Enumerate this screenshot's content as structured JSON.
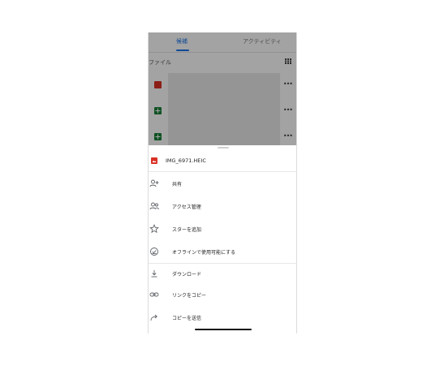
{
  "background_app": {
    "tabs": [
      {
        "label": "候補",
        "active": true
      },
      {
        "label": "アクティビティ",
        "active": false
      }
    ],
    "section_label": "ファイル",
    "files": [
      {
        "icon": "image-file-icon",
        "color": "#d93025"
      },
      {
        "icon": "sheets-file-icon",
        "color": "#188038"
      },
      {
        "icon": "sheets-file-icon",
        "color": "#188038"
      }
    ],
    "more_label": "•••"
  },
  "sheet": {
    "file_name": "IMG_6971.HEIC",
    "file_icon": "image-file-icon",
    "menu_groups": [
      [
        {
          "label": "共有",
          "icon": "person-add-icon"
        },
        {
          "label": "アクセス管理",
          "icon": "manage-access-icon"
        },
        {
          "label": "スターを追加",
          "icon": "star-icon"
        },
        {
          "label": "オフラインで使用可能にする",
          "icon": "offline-icon"
        }
      ],
      [
        {
          "label": "ダウンロード",
          "icon": "download-icon"
        },
        {
          "label": "リンクをコピー",
          "icon": "link-icon"
        },
        {
          "label": "コピーを送信",
          "icon": "send-copy-icon"
        }
      ]
    ]
  },
  "colors": {
    "accent": "#1a73e8",
    "image_red": "#d93025",
    "sheets_green": "#188038"
  }
}
